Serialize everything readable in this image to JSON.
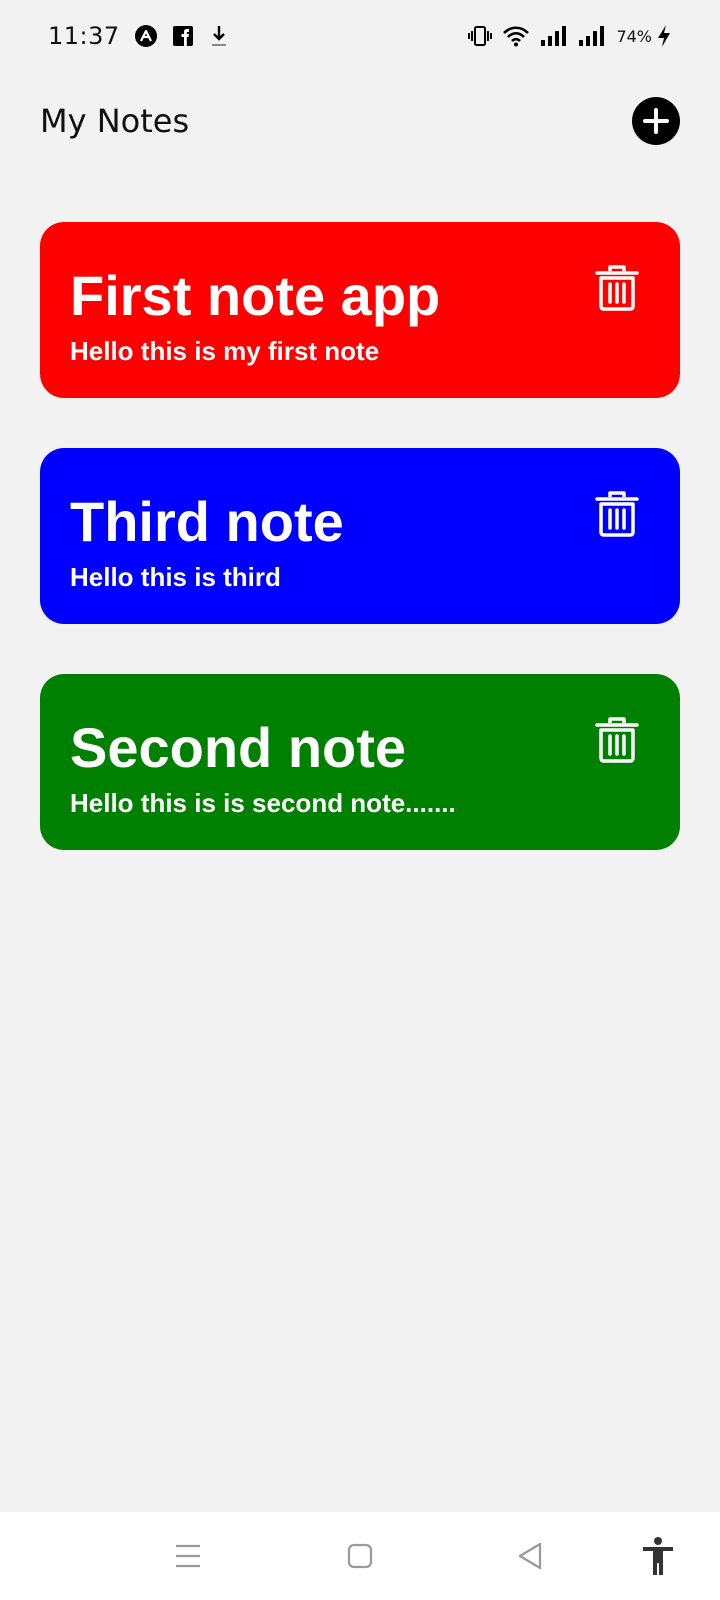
{
  "status_bar": {
    "time": "11:37",
    "battery": "74%",
    "left_icons": [
      "vpn-icon",
      "facebook-icon",
      "download-icon"
    ],
    "right_icons": [
      "vibrate-icon",
      "wifi-icon",
      "signal-icon",
      "signal-icon",
      "charging-icon"
    ]
  },
  "header": {
    "title": "My Notes",
    "add_icon": "plus-icon"
  },
  "notes": [
    {
      "title": "First note app",
      "body": "Hello this is my first note",
      "color": "#ff0000"
    },
    {
      "title": "Third note",
      "body": "Hello this is third",
      "color": "#0000ff"
    },
    {
      "title": "Second note",
      "body": "Hello this is is second note.......",
      "color": "#008000"
    }
  ],
  "nav_bar": {
    "icons": [
      "menu-icon",
      "home-icon",
      "back-icon",
      "accessibility-icon"
    ]
  },
  "colors": {
    "background": "#f2f2f2",
    "nav_background": "#ffffff",
    "text": "#111111"
  }
}
